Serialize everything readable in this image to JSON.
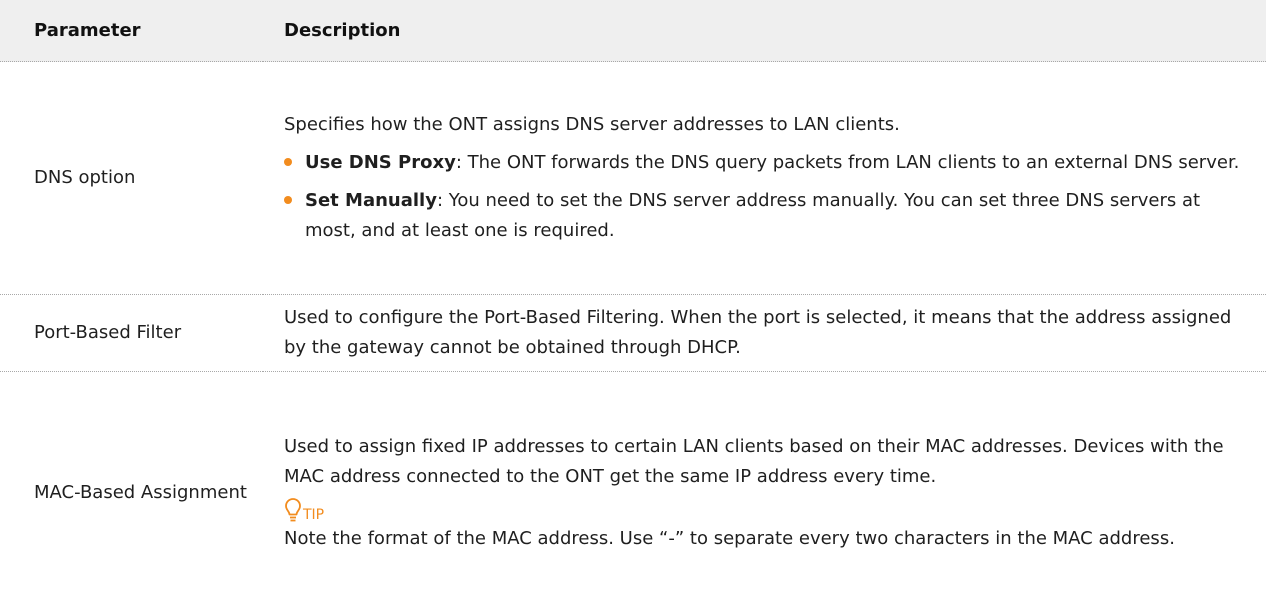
{
  "table": {
    "headers": {
      "parameter": "Parameter",
      "description": "Description"
    },
    "rows": [
      {
        "parameter": "DNS option",
        "intro": "Specifies how the ONT assigns DNS server addresses to LAN clients.",
        "bullets": [
          {
            "term": "Use DNS Proxy",
            "text": ": The ONT forwards the DNS query packets from LAN clients to an external DNS server."
          },
          {
            "term": "Set Manually",
            "text": ": You need to set the DNS server address manually. You can set three DNS servers at most, and at least one is required."
          }
        ]
      },
      {
        "parameter": "Port-Based Filter",
        "description": "Used to configure the Port-Based Filtering. When the port is selected, it means that the address assigned by the gateway cannot be obtained through DHCP."
      },
      {
        "parameter": "MAC-Based Assignment",
        "description": "Used to assign fixed IP addresses to certain LAN clients based on their MAC addresses. Devices with the MAC address connected to the ONT get the same IP address every time.",
        "tip_icon": "lightbulb-icon",
        "tip_label": "TIP",
        "tip_text": "Note the format of the MAC address. Use “-” to separate every two characters in the MAC address."
      }
    ]
  },
  "colors": {
    "accent": "#f28c1e",
    "header_background": "#efefef",
    "text": "#1f1f1f"
  }
}
